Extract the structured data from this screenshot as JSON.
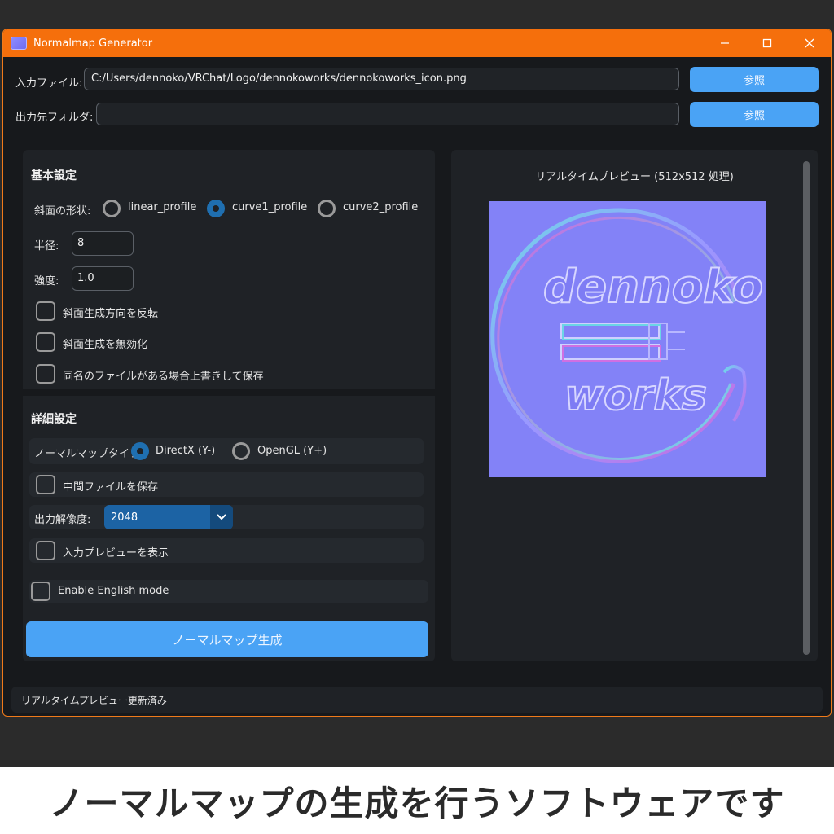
{
  "window": {
    "title": "Normalmap Generator",
    "accent": "#f56f0c"
  },
  "input_file": {
    "label": "入力ファイル:",
    "value": "C:/Users/dennoko/VRChat/Logo/dennokoworks/dennokoworks_icon.png",
    "browse_label": "参照"
  },
  "output_folder": {
    "label": "出力先フォルダ:",
    "value": "",
    "browse_label": "参照"
  },
  "basic_settings": {
    "title": "基本設定",
    "bevel_shape_label": "斜面の形状:",
    "bevel_options": [
      "linear_profile",
      "curve1_profile",
      "curve2_profile"
    ],
    "bevel_selected": "curve1_profile",
    "radius_label": "半径:",
    "radius_value": "8",
    "strength_label": "強度:",
    "strength_value": "1.0",
    "checkboxes": [
      {
        "label": "斜面生成方向を反転",
        "checked": false
      },
      {
        "label": "斜面生成を無効化",
        "checked": false
      },
      {
        "label": "同名のファイルがある場合上書きして保存",
        "checked": false
      }
    ]
  },
  "advanced_settings": {
    "title": "詳細設定",
    "normal_type_label": "ノーマルマップタイプ:",
    "normal_type_options": [
      "DirectX (Y-)",
      "OpenGL (Y+)"
    ],
    "normal_type_selected": "DirectX (Y-)",
    "save_intermediate_label": "中間ファイルを保存",
    "resolution_label": "出力解像度:",
    "resolution_value": "2048",
    "show_input_preview_label": "入力プレビューを表示",
    "english_mode_label": "Enable English mode"
  },
  "generate_button": "ノーマルマップ生成",
  "preview": {
    "title": "リアルタイムプレビュー (512x512 処理)",
    "image_text_top": "dennoko",
    "image_text_bottom": "works"
  },
  "status": "リアルタイムプレビュー更新済み",
  "caption": "ノーマルマップの生成を行うソフトウェアです"
}
